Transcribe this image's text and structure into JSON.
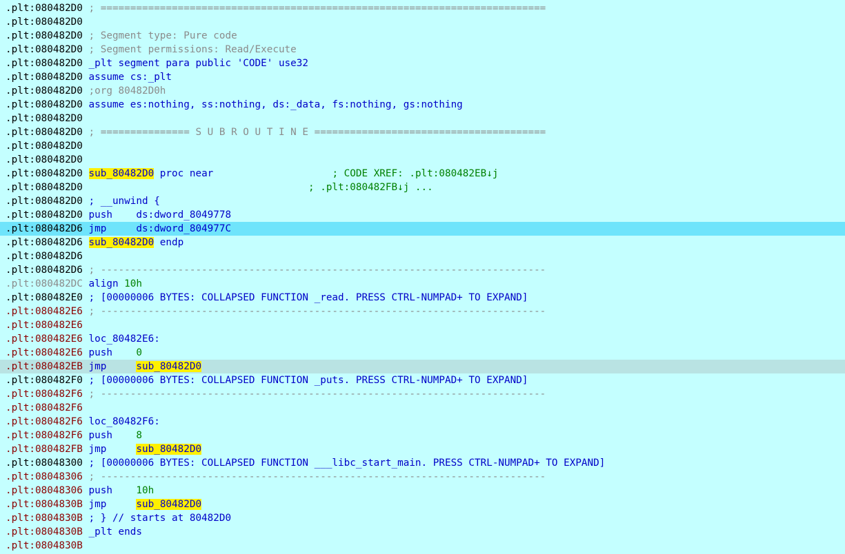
{
  "lines": [
    {
      "addr": ".plt:080482D0",
      "tone": "black",
      "parts": [
        {
          "t": "; ===========================================================================",
          "c": "cmt"
        }
      ]
    },
    {
      "addr": ".plt:080482D0",
      "tone": "black",
      "parts": []
    },
    {
      "addr": ".plt:080482D0",
      "tone": "black",
      "parts": [
        {
          "t": "; Segment type: Pure code",
          "c": "cmt"
        }
      ]
    },
    {
      "addr": ".plt:080482D0",
      "tone": "black",
      "parts": [
        {
          "t": "; Segment permissions: Read/Execute",
          "c": "cmt"
        }
      ]
    },
    {
      "addr": ".plt:080482D0",
      "tone": "black",
      "parts": [
        {
          "t": "_plt segment para public 'CODE' use32",
          "c": "kw"
        }
      ]
    },
    {
      "addr": ".plt:080482D0",
      "tone": "black",
      "parts": [
        {
          "t": "assume cs:_plt",
          "c": "kw"
        }
      ]
    },
    {
      "addr": ".plt:080482D0",
      "tone": "black",
      "parts": [
        {
          "t": ";org 80482D0h",
          "c": "cmt"
        }
      ]
    },
    {
      "addr": ".plt:080482D0",
      "tone": "black",
      "parts": [
        {
          "t": "assume es:nothing, ss:nothing, ds:_data, fs:nothing, gs:nothing",
          "c": "kw"
        }
      ]
    },
    {
      "addr": ".plt:080482D0",
      "tone": "black",
      "parts": []
    },
    {
      "addr": ".plt:080482D0",
      "tone": "black",
      "parts": [
        {
          "t": "; =============== S U B R O U T I N E =======================================",
          "c": "cmt"
        }
      ]
    },
    {
      "addr": ".plt:080482D0",
      "tone": "black",
      "parts": []
    },
    {
      "addr": ".plt:080482D0",
      "tone": "black",
      "parts": []
    },
    {
      "addr": ".plt:080482D0",
      "tone": "black",
      "parts": [
        {
          "t": "sub_80482D0",
          "c": "hl"
        },
        {
          "t": " proc near                    ",
          "c": "kw"
        },
        {
          "t": "; CODE XREF: .plt:080482EB↓j",
          "c": "xref"
        }
      ]
    },
    {
      "addr": ".plt:080482D0",
      "tone": "black",
      "parts": [
        {
          "t": "                                     ",
          "c": "kw"
        },
        {
          "t": "; .plt:080482FB↓j ...",
          "c": "xref"
        }
      ]
    },
    {
      "addr": ".plt:080482D0",
      "tone": "black",
      "parts": [
        {
          "t": "; __unwind {",
          "c": "kw"
        }
      ]
    },
    {
      "addr": ".plt:080482D0",
      "tone": "black",
      "parts": [
        {
          "t": "push    ds:dword_8049778",
          "c": "kw"
        }
      ]
    },
    {
      "addr": ".plt:080482D6",
      "tone": "black",
      "row": "sel",
      "parts": [
        {
          "t": "jmp     ds:dword_804977C",
          "c": "kw"
        }
      ]
    },
    {
      "addr": ".plt:080482D6",
      "tone": "black",
      "parts": [
        {
          "t": "sub_80482D0",
          "c": "hl"
        },
        {
          "t": " endp",
          "c": "kw"
        }
      ]
    },
    {
      "addr": ".plt:080482D6",
      "tone": "black",
      "parts": []
    },
    {
      "addr": ".plt:080482D6",
      "tone": "black",
      "parts": [
        {
          "t": "; ---------------------------------------------------------------------------",
          "c": "cmt"
        }
      ]
    },
    {
      "addr": ".plt:080482DC",
      "tone": "gray",
      "parts": [
        {
          "t": "align ",
          "c": "kw"
        },
        {
          "t": "10h",
          "c": "num"
        }
      ]
    },
    {
      "addr": ".plt:080482E0",
      "tone": "black",
      "parts": [
        {
          "t": "; [00000006 BYTES: COLLAPSED FUNCTION _read. PRESS CTRL-NUMPAD+ TO EXPAND]",
          "c": "kw"
        }
      ]
    },
    {
      "addr": ".plt:080482E6",
      "tone": "red",
      "parts": [
        {
          "t": "; ---------------------------------------------------------------------------",
          "c": "cmt"
        }
      ]
    },
    {
      "addr": ".plt:080482E6",
      "tone": "red",
      "parts": []
    },
    {
      "addr": ".plt:080482E6",
      "tone": "red",
      "parts": [
        {
          "t": "loc_80482E6:",
          "c": "kw"
        }
      ]
    },
    {
      "addr": ".plt:080482E6",
      "tone": "red",
      "parts": [
        {
          "t": "push    ",
          "c": "kw"
        },
        {
          "t": "0",
          "c": "num"
        }
      ]
    },
    {
      "addr": ".plt:080482EB",
      "tone": "red",
      "row": "cur",
      "parts": [
        {
          "t": "jmp     ",
          "c": "kw"
        },
        {
          "t": "sub_8048",
          "c": "hl"
        },
        {
          "t": "CARET",
          "c": "caret"
        },
        {
          "t": "2D0",
          "c": "hl"
        }
      ]
    },
    {
      "addr": ".plt:080482F0",
      "tone": "black",
      "parts": [
        {
          "t": "; [00000006 BYTES: COLLAPSED FUNCTION _puts. PRESS CTRL-NUMPAD+ TO EXPAND]",
          "c": "kw"
        }
      ]
    },
    {
      "addr": ".plt:080482F6",
      "tone": "red",
      "parts": [
        {
          "t": "; ---------------------------------------------------------------------------",
          "c": "cmt"
        }
      ]
    },
    {
      "addr": ".plt:080482F6",
      "tone": "red",
      "parts": []
    },
    {
      "addr": ".plt:080482F6",
      "tone": "red",
      "parts": [
        {
          "t": "loc_80482F6:",
          "c": "kw"
        }
      ]
    },
    {
      "addr": ".plt:080482F6",
      "tone": "red",
      "parts": [
        {
          "t": "push    ",
          "c": "kw"
        },
        {
          "t": "8",
          "c": "num"
        }
      ]
    },
    {
      "addr": ".plt:080482FB",
      "tone": "red",
      "parts": [
        {
          "t": "jmp     ",
          "c": "kw"
        },
        {
          "t": "sub_80482D0",
          "c": "hl"
        }
      ]
    },
    {
      "addr": ".plt:08048300",
      "tone": "black",
      "parts": [
        {
          "t": "; [00000006 BYTES: COLLAPSED FUNCTION ___libc_start_main. PRESS CTRL-NUMPAD+ TO EXPAND]",
          "c": "kw"
        }
      ]
    },
    {
      "addr": ".plt:08048306",
      "tone": "red",
      "parts": [
        {
          "t": "; ---------------------------------------------------------------------------",
          "c": "cmt"
        }
      ]
    },
    {
      "addr": ".plt:08048306",
      "tone": "red",
      "parts": [
        {
          "t": "push    ",
          "c": "kw"
        },
        {
          "t": "10h",
          "c": "num"
        }
      ]
    },
    {
      "addr": ".plt:0804830B",
      "tone": "red",
      "parts": [
        {
          "t": "jmp     ",
          "c": "kw"
        },
        {
          "t": "sub_80482D0",
          "c": "hl"
        }
      ]
    },
    {
      "addr": ".plt:0804830B",
      "tone": "red",
      "parts": [
        {
          "t": "; } // starts at 80482D0",
          "c": "kw"
        }
      ]
    },
    {
      "addr": ".plt:0804830B",
      "tone": "red",
      "parts": [
        {
          "t": "_plt ends",
          "c": "kw"
        }
      ]
    },
    {
      "addr": ".plt:0804830B",
      "tone": "red",
      "parts": []
    }
  ],
  "colors": {
    "background": "#c4ffff",
    "selected_row": "#6fe4fb",
    "cursor_row": "#b9e3e3",
    "highlight": "#fff000",
    "instruction": "#0000c8",
    "comment": "#8b8b8b",
    "xref": "#008000",
    "address_red": "#8c0000"
  }
}
